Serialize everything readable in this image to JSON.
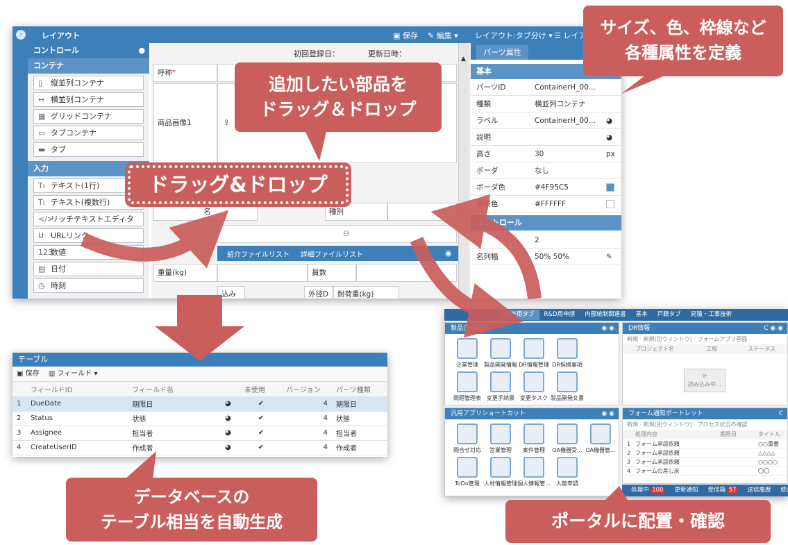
{
  "layout_window": {
    "title": "レイアウト",
    "save": "保存",
    "edit": "編集",
    "layout_select": "レイアウト:タブ分け",
    "layout_btn": "レイア",
    "sidebar": {
      "header": "コントロール",
      "groups": [
        {
          "label": "コンテナ",
          "items": [
            {
              "icon": "vertical-container-icon",
              "label": "縦並列コンテナ"
            },
            {
              "icon": "horizontal-container-icon",
              "label": "横並列コンテナ"
            },
            {
              "icon": "grid-container-icon",
              "label": "グリッドコンテナ"
            },
            {
              "icon": "tab-container-icon",
              "label": "タブコンテナ"
            },
            {
              "icon": "tab-icon",
              "label": "タブ"
            }
          ]
        },
        {
          "label": "入力",
          "items": [
            {
              "icon": "text-icon",
              "label": "テキスト(1行)"
            },
            {
              "icon": "text-icon",
              "label": "テキスト(複数行)"
            },
            {
              "icon": "code-icon",
              "label": "リッチテキストエディタ"
            },
            {
              "icon": "url-icon",
              "label": "URLリンク"
            },
            {
              "icon": "number-icon",
              "label": "数値"
            },
            {
              "icon": "calendar-icon",
              "label": "日付"
            },
            {
              "icon": "clock-icon",
              "label": "時刻"
            }
          ]
        }
      ]
    },
    "canvas": {
      "created": "初回登録日：",
      "updated": "更新日時：",
      "name_label": "呼称",
      "required_mark": "*",
      "image_label": "商品画像1",
      "label_a": "名",
      "label_kind": "種別",
      "tabs": [
        "紹介ファイルリスト",
        "詳細ファイルリスト"
      ],
      "weight": "重量(kg)",
      "member": "員数",
      "label_b": "込み",
      "outer": "外径D",
      "load": "耐荷重(kg)"
    },
    "props": {
      "tab": "パーツ属性",
      "section_basic": "基本",
      "section_layout": "コントロール",
      "rows": [
        {
          "key": "パーツID",
          "value": "ContainerH_00...",
          "icon": ""
        },
        {
          "key": "種類",
          "value": "横並列コンテナ",
          "icon": ""
        },
        {
          "key": "ラベル",
          "value": "ContainerH_00...",
          "icon": "globe-icon"
        },
        {
          "key": "説明",
          "value": "",
          "icon": "globe-icon"
        },
        {
          "key": "高さ",
          "value": "30",
          "icon": "px"
        },
        {
          "key": "ボーダ",
          "value": "なし",
          "icon": ""
        },
        {
          "key": "ボーダ色",
          "value": "#4F95C5",
          "icon": "swatch",
          "color": "#4F95C5"
        },
        {
          "key": "背景色",
          "value": "#FFFFFF",
          "icon": "swatch",
          "color": "#FFFFFF"
        }
      ],
      "rows2": [
        {
          "key": "",
          "value": "2"
        },
        {
          "key": "名列幅",
          "value": "50% 50%"
        }
      ]
    }
  },
  "callouts": {
    "add_part": [
      "追加したい部品を",
      "ドラッグ＆ドロップ"
    ],
    "dnd": "ドラッグ&ドロップ",
    "attrs": [
      "サイズ、色、枠線など",
      "各種属性を定義"
    ],
    "db": [
      "データベースの",
      "テーブル相当を自動生成"
    ],
    "portal": "ポータルに配置・確認"
  },
  "table_window": {
    "title": "テーブル",
    "save": "保存",
    "field_btn": "フィールド",
    "columns": [
      "フィールドID",
      "フィールド名",
      "",
      "未使用",
      "バージョン",
      "パーツ種類"
    ],
    "rows": [
      {
        "n": "1",
        "id": "DueDate",
        "name": "期限日",
        "ver": "4",
        "type": "期限日"
      },
      {
        "n": "2",
        "id": "Status",
        "name": "状態",
        "ver": "4",
        "type": "状態"
      },
      {
        "n": "3",
        "id": "Assignee",
        "name": "担当者",
        "ver": "4",
        "type": "担当者"
      },
      {
        "n": "4",
        "id": "CreateUserID",
        "name": "作成者",
        "ver": "4",
        "type": "作成者"
      }
    ]
  },
  "portal": {
    "tabs": [
      "デモ用タブ",
      "R&D用申請",
      "内部統制関連書",
      "基本",
      "戸籍タブ",
      "見積・工事技術"
    ],
    "panel1": {
      "title": "製品企画開発",
      "tiles": [
        "企業管理",
        "製品開発情報",
        "DR情報管理",
        "DR指摘事項",
        "問題管理表",
        "変更手続票",
        "変更タスク",
        "製品開発文書"
      ]
    },
    "panel2": {
      "title": "DR情報",
      "toolbar": [
        "新規",
        "新規(別ウィンドウ)",
        "フォームアプリ画面"
      ],
      "cols": [
        "プロジェクト名",
        "工程",
        "ステータス"
      ],
      "loading": "読み込み中..."
    },
    "panel3": {
      "title": "汎用アプリショートカット",
      "tiles": [
        "問合せ対応",
        "営業管理",
        "案件管理",
        "OA機器受...",
        "OA機器管...",
        "ToDo管理",
        "人材情報管理",
        "個人情報管...",
        "入館申請"
      ]
    },
    "panel4": {
      "title": "フォーム通知ポートレット",
      "toolbar": [
        "新規",
        "新規(別ウィンドウ)",
        "プロセス状況の確認"
      ],
      "cols": [
        "処理内容",
        "期限日",
        "タイトル"
      ],
      "rows": [
        {
          "n": "1",
          "t": "フォーム承認依頼",
          "v": "○○重要"
        },
        {
          "n": "2",
          "t": "フォーム承認依頼",
          "v": "△△△△"
        },
        {
          "n": "3",
          "t": "フォーム承認依頼",
          "v": "○○○○"
        },
        {
          "n": "4",
          "t": "フォームの差し戻",
          "v": "〇〇"
        }
      ]
    },
    "status": [
      {
        "label": "処理中",
        "badge": "100"
      },
      {
        "label": "更新通知",
        "badge": ""
      },
      {
        "label": "受信箱",
        "badge": "57"
      },
      {
        "label": "送信履歴",
        "badge": ""
      },
      {
        "label": "統計",
        "badge": ""
      }
    ]
  },
  "colors": {
    "callout": "#c95e5c",
    "accent": "#3d7fb8",
    "group": "#5b93c7"
  }
}
